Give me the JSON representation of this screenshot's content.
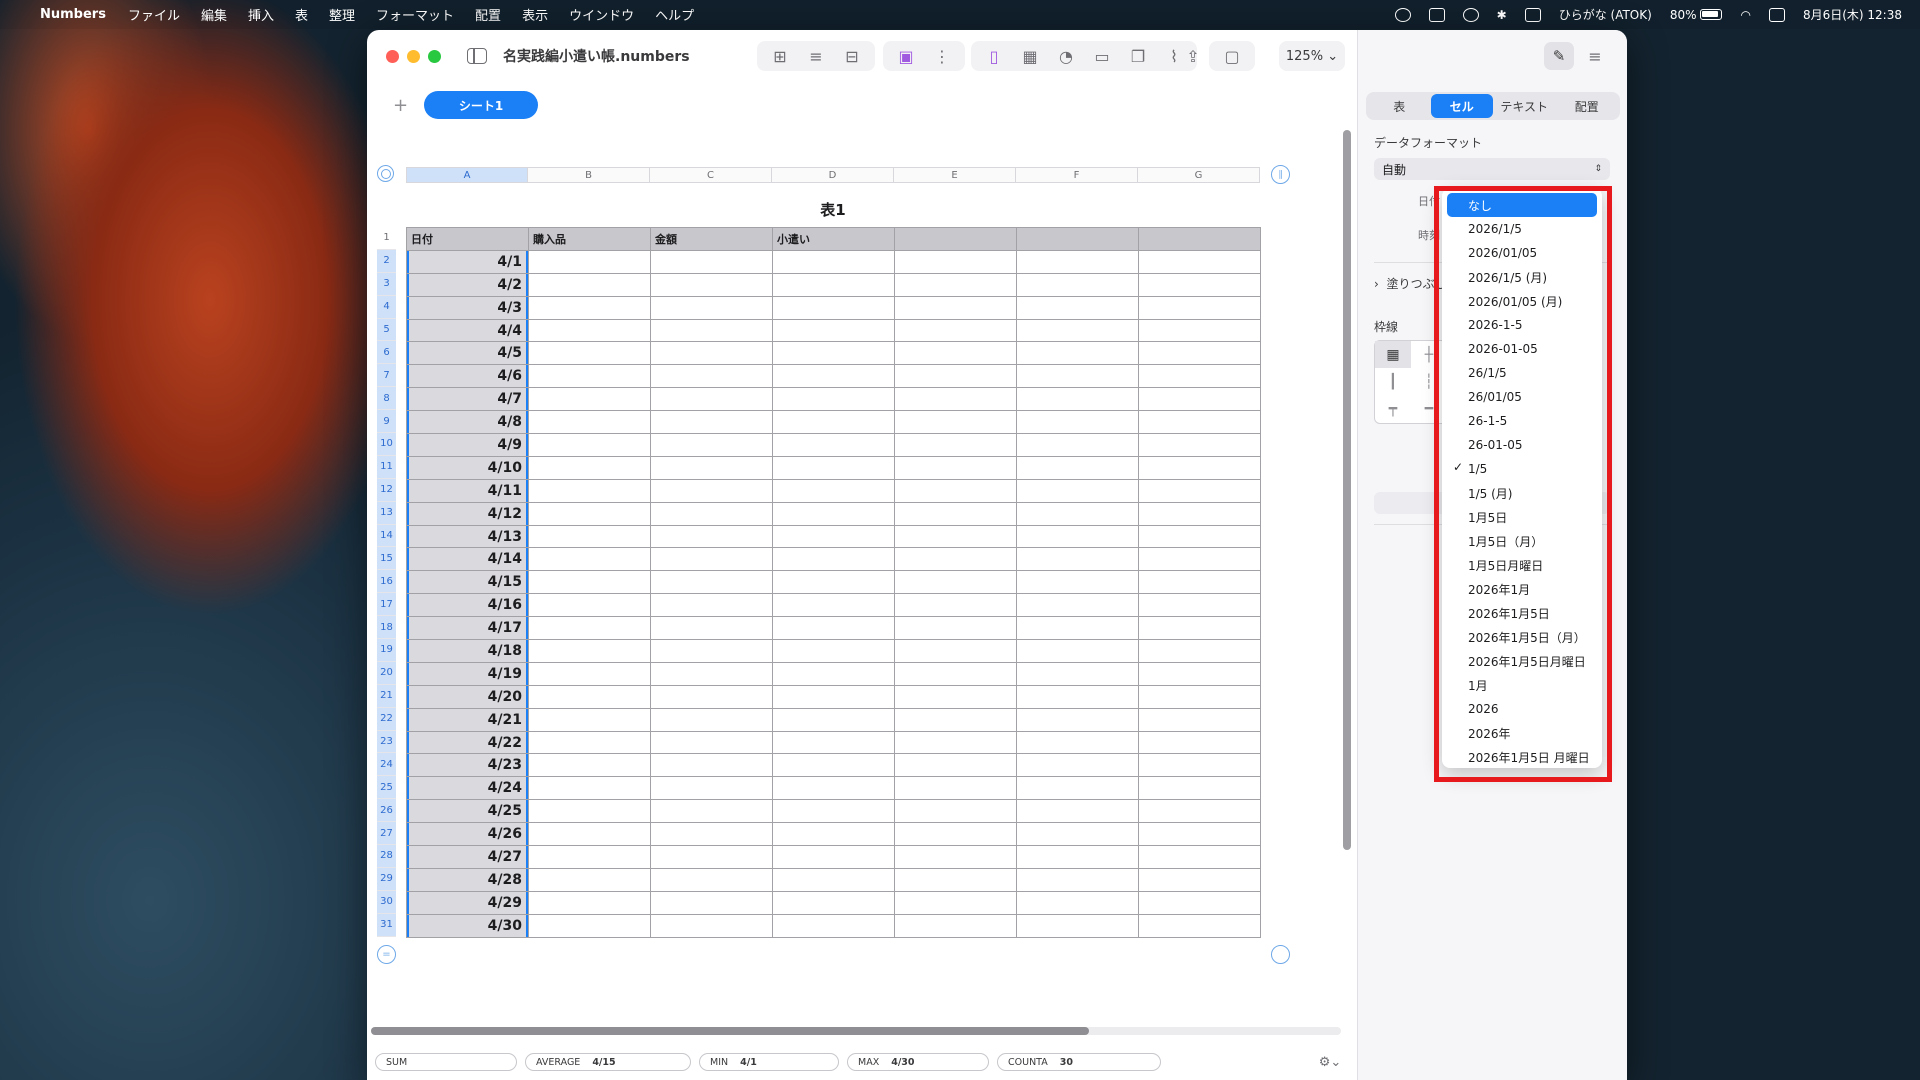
{
  "menubar": {
    "app_name": "Numbers",
    "items": [
      "ファイル",
      "編集",
      "挿入",
      "表",
      "整理",
      "フォーマット",
      "配置",
      "表示",
      "ウインドウ",
      "ヘルプ"
    ],
    "input_method": "ひらがな (ATOK)",
    "battery": "80%",
    "datetime": "8月6日(木) 12:38"
  },
  "window": {
    "title": "名実践編小遣い帳.numbers",
    "zoom": "125%",
    "sheet_tab": "シート1"
  },
  "sheet": {
    "table_title": "表1",
    "column_letters": [
      "A",
      "B",
      "C",
      "D",
      "E",
      "F",
      "G"
    ],
    "header_row": [
      "日付",
      "購入品",
      "金額",
      "小遣い",
      "",
      "",
      ""
    ],
    "row_numbers": [
      "1",
      "2",
      "3",
      "4",
      "5",
      "6",
      "7",
      "8",
      "9",
      "10",
      "11",
      "12",
      "13",
      "14",
      "15",
      "16",
      "17",
      "18",
      "19",
      "20",
      "21",
      "22",
      "23",
      "24",
      "25",
      "26",
      "27",
      "28",
      "29",
      "30",
      "31"
    ],
    "dates": [
      "4/1",
      "4/2",
      "4/3",
      "4/4",
      "4/5",
      "4/6",
      "4/7",
      "4/8",
      "4/9",
      "4/10",
      "4/11",
      "4/12",
      "4/13",
      "4/14",
      "4/15",
      "4/16",
      "4/17",
      "4/18",
      "4/19",
      "4/20",
      "4/21",
      "4/22",
      "4/23",
      "4/24",
      "4/25",
      "4/26",
      "4/27",
      "4/28",
      "4/29",
      "4/30"
    ]
  },
  "statusbar": {
    "sum_label": "SUM",
    "average_label": "AVERAGE",
    "average_value": "4/15",
    "min_label": "MIN",
    "min_value": "4/1",
    "max_label": "MAX",
    "max_value": "4/30",
    "counta_label": "COUNTA",
    "counta_value": "30"
  },
  "inspector": {
    "tabs": [
      "表",
      "セル",
      "テキスト",
      "配置"
    ],
    "active_tab": "セル",
    "data_format_label": "データフォーマット",
    "data_format_value": "自動",
    "date_label_partial": "日付",
    "time_label_partial": "時刻",
    "fill_label": "塗りつぶし",
    "border_label": "枠線"
  },
  "dropdown": {
    "items": [
      "なし",
      "2026/1/5",
      "2026/01/05",
      "2026/1/5 (月)",
      "2026/01/05 (月)",
      "2026-1-5",
      "2026-01-05",
      "26/1/5",
      "26/01/05",
      "26-1-5",
      "26-01-05",
      "1/5",
      "1/5 (月)",
      "1月5日",
      "1月5日（月）",
      "1月5日月曜日",
      "2026年1月",
      "2026年1月5日",
      "2026年1月5日（月）",
      "2026年1月5日月曜日",
      "1月",
      "2026",
      "2026年",
      "2026年1月5日 月曜日"
    ],
    "highlighted": "なし",
    "checked": "1/5"
  },
  "colors": {
    "accent": "#1b7ff5",
    "annotation_box": "#e8191c"
  }
}
